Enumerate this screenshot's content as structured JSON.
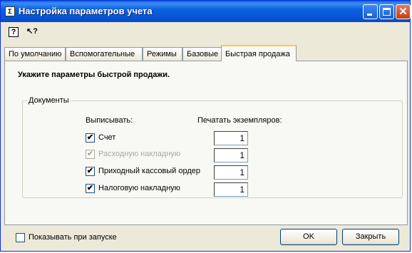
{
  "window": {
    "title": "Настройка параметров учета",
    "icon": "app-icon"
  },
  "toolbar": {
    "help_icon": "?",
    "context_help_icon": "↖?"
  },
  "tabs": [
    {
      "label": "По умолчанию"
    },
    {
      "label": "Вспомогательные"
    },
    {
      "label": "Режимы"
    },
    {
      "label": "Базовые"
    },
    {
      "label": "Быстрая продажа"
    }
  ],
  "active_tab": "Быстрая продажа",
  "panel": {
    "heading": "Укажите параметры быстрой продажи.",
    "group_title": "Документы",
    "issue_label": "Выписывать:",
    "copies_label": "Печатать экземпляров:",
    "rows": [
      {
        "label": "Счет",
        "checked": true,
        "disabled": false,
        "copies": "1"
      },
      {
        "label": "Расходную накладную",
        "checked": true,
        "disabled": true,
        "copies": "1"
      },
      {
        "label": "Приходный кассовый ордер",
        "checked": true,
        "disabled": false,
        "copies": "1"
      },
      {
        "label": "Налоговую накладную",
        "checked": true,
        "disabled": false,
        "copies": "1"
      }
    ]
  },
  "footer": {
    "show_on_start_label": "Показывать при запуске",
    "show_on_start_checked": false,
    "ok_label": "OK",
    "close_label": "Закрыть"
  },
  "colors": {
    "titlebar": "#0553d6",
    "window_bg": "#ece9d8",
    "panel_bg": "#f8f8f4",
    "active_tab_accent": "#ffc83c"
  }
}
